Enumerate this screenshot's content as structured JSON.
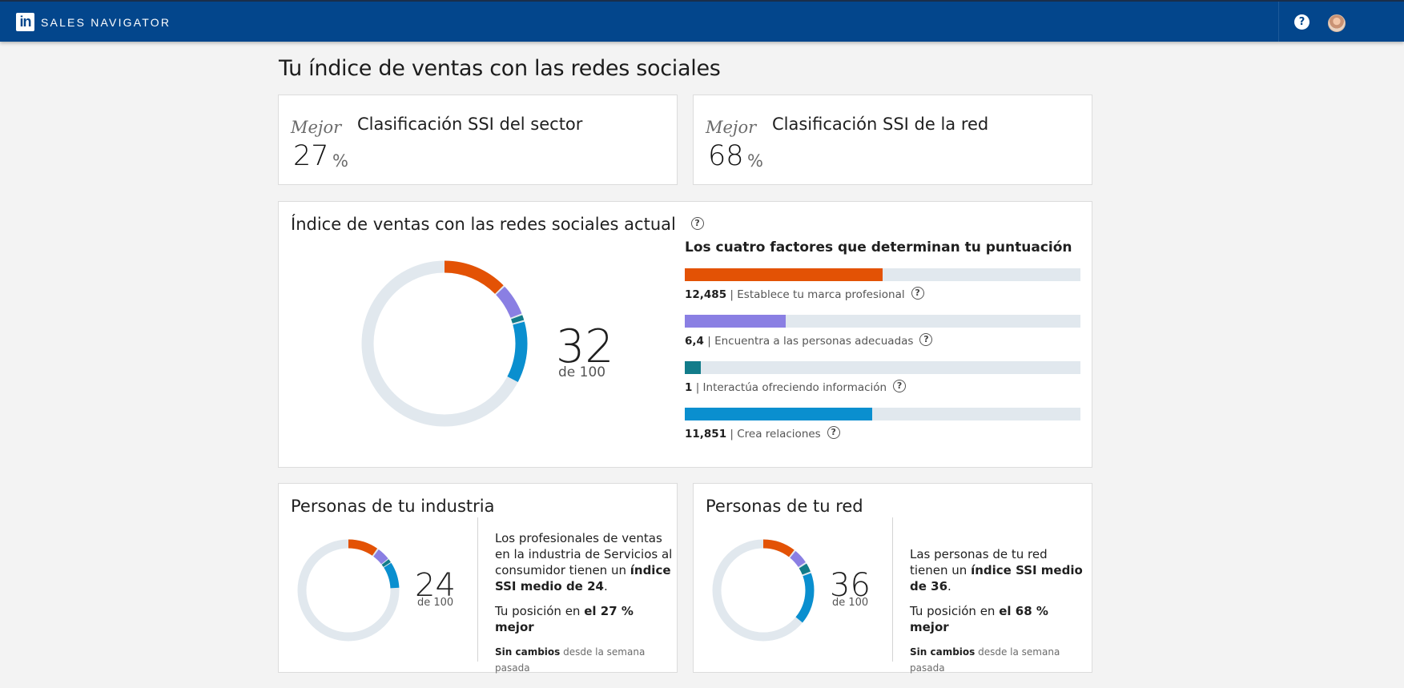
{
  "header": {
    "logo": "in",
    "brand": "SALES NAVIGATOR",
    "help_icon": "?",
    "avatar": "user-avatar"
  },
  "page": {
    "title": "Tu índice de ventas con las redes sociales"
  },
  "rank_cards": [
    {
      "better_label": "Mejor",
      "title": "Clasificación SSI del sector",
      "value": "27",
      "unit": "%"
    },
    {
      "better_label": "Mejor",
      "title": "Clasificación SSI de la red",
      "value": "68",
      "unit": "%"
    }
  ],
  "current": {
    "title": "Índice de ventas con las redes sociales actual",
    "score": "32",
    "of": "de 100",
    "factors_title": "Los cuatro factores que determinan tu puntuación",
    "factors": [
      {
        "value": "12,485",
        "label": "Establece tu marca profesional",
        "fill": 0.4994,
        "color": "#e35205"
      },
      {
        "value": "6,4",
        "label": "Encuentra a las personas adecuadas",
        "fill": 0.256,
        "color": "#8a7fe3"
      },
      {
        "value": "1",
        "label": "Interactúa ofreciendo información",
        "fill": 0.04,
        "color": "#127c8a"
      },
      {
        "value": "11,851",
        "label": "Crea relaciones",
        "fill": 0.474,
        "color": "#0a8fcf"
      }
    ]
  },
  "industry": {
    "title": "Personas de tu industria",
    "score": "24",
    "of": "de 100",
    "text_pre": "Los profesionales de ventas en la industria de Servicios al consumidor tienen un ",
    "text_bold": "índice SSI medio de 24",
    "text_post": ".",
    "position_pre": "Tu posición en ",
    "position_bold": "el 27 % mejor",
    "change_bold": "Sin cambios",
    "change_rest": " desde la semana pasada"
  },
  "network": {
    "title": "Personas de tu red",
    "score": "36",
    "of": "de 100",
    "text_pre": "Las personas de tu red tienen un ",
    "text_bold": "índice SSI medio de 36",
    "text_post": ".",
    "position_pre": "Tu posición en ",
    "position_bold": "el 68 % mejor",
    "change_bold": "Sin cambios",
    "change_rest": " desde la semana pasada"
  },
  "colors": {
    "brand_blue": "#03468c",
    "orange": "#e35205",
    "purple": "#8a7fe3",
    "teal": "#127c8a",
    "blue": "#0a8fcf",
    "track": "#e1e8ee"
  }
}
